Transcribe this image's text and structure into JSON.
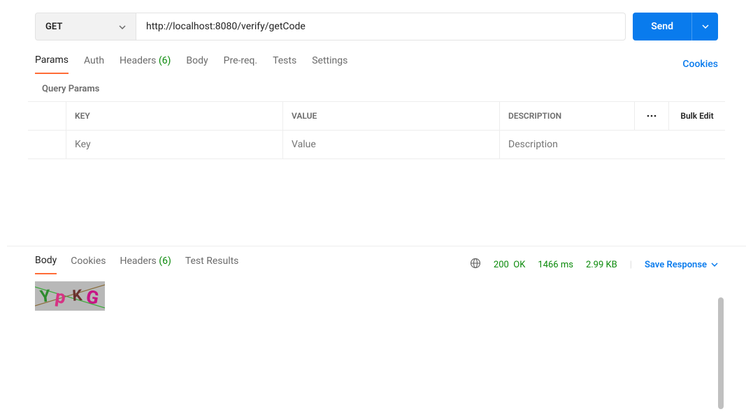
{
  "request": {
    "method": "GET",
    "url": "http://localhost:8080/verify/getCode",
    "send_label": "Send"
  },
  "req_tabs": {
    "params": "Params",
    "auth": "Auth",
    "headers": "Headers",
    "headers_count": "(6)",
    "body": "Body",
    "prereq": "Pre-req.",
    "tests": "Tests",
    "settings": "Settings",
    "cookies": "Cookies"
  },
  "query_params": {
    "title": "Query Params",
    "header_key": "KEY",
    "header_value": "VALUE",
    "header_desc": "DESCRIPTION",
    "bulk_edit": "Bulk Edit",
    "placeholder_key": "Key",
    "placeholder_value": "Value",
    "placeholder_desc": "Description"
  },
  "resp_tabs": {
    "body": "Body",
    "cookies": "Cookies",
    "headers": "Headers",
    "headers_count": "(6)",
    "test_results": "Test Results"
  },
  "response": {
    "status_code": "200",
    "status_text": "OK",
    "time": "1466 ms",
    "size": "2.99 KB",
    "save_label": "Save Response"
  }
}
